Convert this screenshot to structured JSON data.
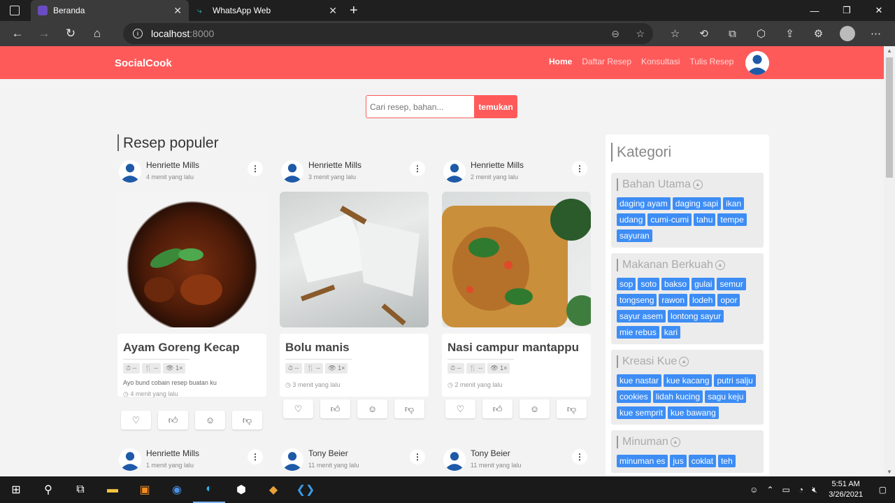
{
  "browser": {
    "tabs": [
      {
        "title": "Beranda",
        "active": true
      },
      {
        "title": "WhatsApp Web",
        "active": false
      }
    ],
    "url_host": "localhost",
    "url_port": ":8000",
    "new_tab": "+"
  },
  "site": {
    "brand": "SocialCook",
    "nav": [
      {
        "label": "Home",
        "active": true
      },
      {
        "label": "Daftar Resep",
        "active": false
      },
      {
        "label": "Konsultasi",
        "active": false
      },
      {
        "label": "Tulis Resep",
        "active": false
      }
    ],
    "search": {
      "placeholder": "Cari resep, bahan...",
      "button": "temukan"
    },
    "section_title": "Resep populer"
  },
  "recipes": [
    {
      "author": "Henriette Mills",
      "time": "4 menit yang lalu",
      "title": "Ayam Goreng Kecap",
      "chips": [
        "⏱ --",
        "🍴 --",
        "👁 1×"
      ],
      "desc": "Ayo bund cobain resep buatan ku",
      "time2": "◷ 4 menit yang lalu"
    },
    {
      "author": "Henriette Mills",
      "time": "3 menit yang lalu",
      "title": "Bolu manis",
      "chips": [
        "⏱ --",
        "🍴 --",
        "👁 1×"
      ],
      "desc": "",
      "time2": "◷ 3 menit yang lalu"
    },
    {
      "author": "Henriette Mills",
      "time": "2 menit yang lalu",
      "title": "Nasi campur mantappu",
      "chips": [
        "⏱ --",
        "🍴 --",
        "👁 1×"
      ],
      "desc": "",
      "time2": "◷ 2 menit yang lalu"
    }
  ],
  "recipes_row2": [
    {
      "author": "Henriette Mills",
      "time": "1 menit yang lalu"
    },
    {
      "author": "Tony Beier",
      "time": "11 menit yang lalu"
    },
    {
      "author": "Tony Beier",
      "time": "11 menit yang lalu"
    }
  ],
  "sidebar": {
    "title": "Kategori",
    "categories": [
      {
        "name": "Bahan Utama",
        "tags": [
          "daging ayam",
          "daging sapi",
          "ikan",
          "udang",
          "cumi-cumi",
          "tahu",
          "tempe",
          "sayuran"
        ]
      },
      {
        "name": "Makanan Berkuah",
        "tags": [
          "sop",
          "soto",
          "bakso",
          "gulai",
          "semur",
          "tongseng",
          "rawon",
          "lodeh",
          "opor",
          "sayur asem",
          "lontong sayur",
          "mie rebus",
          "kari"
        ]
      },
      {
        "name": "Kreasi Kue",
        "tags": [
          "kue nastar",
          "kue kacang",
          "putri salju",
          "cookies",
          "lidah kucing",
          "sagu keju",
          "kue semprit",
          "kue bawang"
        ]
      },
      {
        "name": "Minuman",
        "tags": [
          "minuman es",
          "jus",
          "coklat",
          "teh"
        ]
      }
    ]
  },
  "taskbar": {
    "time": "5:51 AM",
    "date": "3/26/2021"
  },
  "colors": {
    "brand": "#ff5a5a",
    "tag": "#3d8df5"
  }
}
